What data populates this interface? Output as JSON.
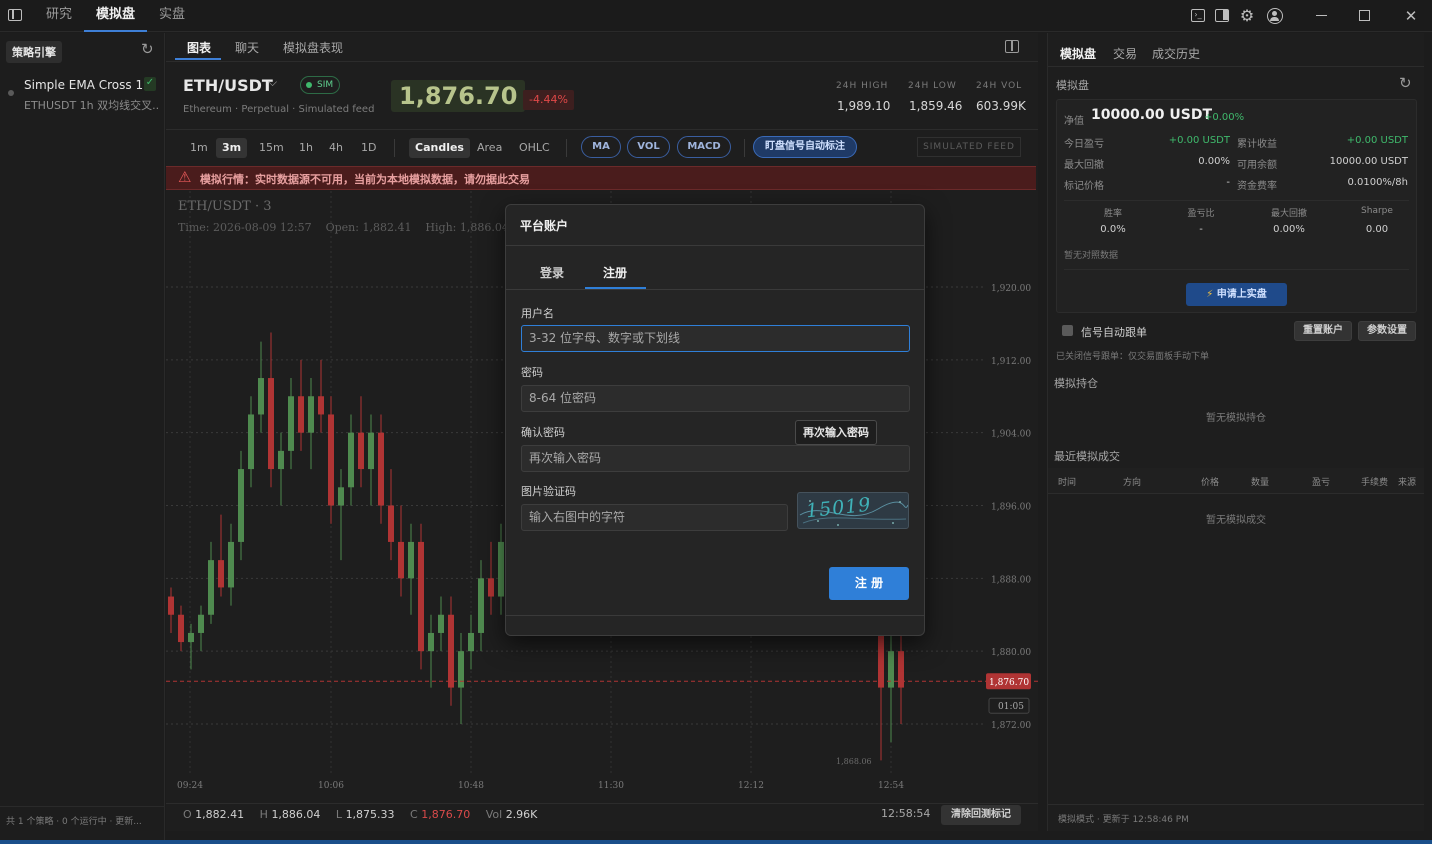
{
  "topbar": {
    "tabs": [
      "研究",
      "模拟盘",
      "实盘"
    ],
    "active_tab": "模拟盘"
  },
  "sidebar": {
    "title": "策略引擎",
    "strategy": {
      "name": "Simple EMA Cross 1h",
      "desc": "ETHUSDT 1h 双均线交叉...",
      "check": "✓"
    },
    "footer": "共 1 个策略 · 0 个运行中 · 更新..."
  },
  "chart_header": {
    "tabs": [
      "图表",
      "聊天",
      "模拟盘表现"
    ],
    "symbol": "ETH/USDT",
    "sim_badge": "SIM",
    "subtitle": "Ethereum · Perpetual · Simulated feed",
    "price": "1,876.70",
    "change": "-4.44%",
    "stats": [
      {
        "label": "24H HIGH",
        "value": "1,989.10"
      },
      {
        "label": "24H LOW",
        "value": "1,859.46"
      },
      {
        "label": "24H VOL",
        "value": "603.99K"
      }
    ]
  },
  "toolbar": {
    "timeframes": [
      "1m",
      "3m",
      "15m",
      "1h",
      "4h",
      "1D"
    ],
    "active_timeframe": "3m",
    "chart_types": [
      "Candles",
      "Area",
      "OHLC"
    ],
    "active_chart_type": "Candles",
    "indicators": [
      "MA",
      "VOL",
      "MACD"
    ],
    "signal_button": "盯盘信号自动标注",
    "feed_badge": "SIMULATED FEED"
  },
  "warning": "模拟行情：实时数据源不可用，当前为本地模拟数据，请勿据此交易",
  "legend": {
    "title": "ETH/USDT · 3",
    "line": "Time: 2026-08-09 12:57    Open: 1,882.41    High: 1,886.04    Lo"
  },
  "axes": {
    "price_ticks": [
      "1,920.00",
      "1,912.00",
      "1,904.00",
      "1,896.00",
      "1,888.00",
      "1,880.00",
      "1,872.00"
    ],
    "time_ticks": [
      "09:24",
      "10:06",
      "10:48",
      "11:30",
      "12:12",
      "12:54"
    ],
    "last_price_tag": "1,876.70",
    "countdown": "01:05",
    "low_marker": "1,868.06"
  },
  "status_bar": {
    "o_label": "O",
    "o": "1,882.41",
    "h_label": "H",
    "h": "1,886.04",
    "l_label": "L",
    "l": "1,875.33",
    "c_label": "C",
    "c": "1,876.70",
    "vol_label": "Vol",
    "vol": "2.96K",
    "time": "12:58:54",
    "clear_button": "清除回测标记"
  },
  "right": {
    "tabs": [
      "模拟盘",
      "交易",
      "成交历史"
    ],
    "section_title": "模拟盘",
    "equity_label": "净值",
    "equity": "10000.00 USDT",
    "equity_change": "+0.00%",
    "rows": [
      {
        "l1": "今日盈亏",
        "v1": "+0.00 USDT",
        "l2": "累计收益",
        "v2": "+0.00 USDT"
      },
      {
        "l1": "最大回撤",
        "v1": "0.00%",
        "l2": "可用余额",
        "v2": "10000.00 USDT"
      },
      {
        "l1": "标记价格",
        "v1": "-",
        "l2": "资金费率",
        "v2": "0.0100%/8h"
      }
    ],
    "metrics": [
      {
        "label": "胜率",
        "value": "0.0%"
      },
      {
        "label": "盈亏比",
        "value": "-"
      },
      {
        "label": "最大回撤",
        "value": "0.00%"
      },
      {
        "label": "Sharpe",
        "value": "0.00"
      }
    ],
    "no_compare": "暂无对照数据",
    "apply_button": "申请上实盘",
    "auto_follow": "信号自动跟单",
    "reset_button": "重置账户",
    "params_button": "参数设置",
    "auto_follow_note": "已关闭信号跟单：仅交易面板手动下单",
    "positions_title": "模拟持仓",
    "positions_empty": "暂无模拟持仓",
    "trades_title": "最近模拟成交",
    "trade_cols": [
      "时间",
      "方向",
      "价格",
      "数量",
      "盈亏",
      "手续费",
      "来源"
    ],
    "trades_empty": "暂无模拟成交",
    "footer": "模拟模式 · 更新于 12:58:46 PM"
  },
  "modal": {
    "title": "平台账户",
    "tabs": [
      "登录",
      "注册"
    ],
    "active_tab": "注册",
    "username_label": "用户名",
    "username_placeholder": "3-32 位字母、数字或下划线",
    "password_label": "密码",
    "password_placeholder": "8-64 位密码",
    "confirm_label": "确认密码",
    "confirm_placeholder": "再次输入密码",
    "confirm_tooltip": "再次输入密码",
    "captcha_label": "图片验证码",
    "captcha_placeholder": "输入右图中的字符",
    "captcha_text": "15019",
    "submit": "注 册"
  },
  "colors": {
    "accent": "#2f7fd8",
    "up": "#4f8a4f",
    "down": "#b03434",
    "warning_bg": "#4a1c1c"
  },
  "chart_data": {
    "type": "candlestick",
    "timeframe": "3m",
    "ylim": [
      1866,
      1922
    ],
    "candles": [
      [
        1886,
        1887,
        1882,
        1884
      ],
      [
        1884,
        1885,
        1880,
        1881
      ],
      [
        1881,
        1883,
        1878,
        1882
      ],
      [
        1882,
        1885,
        1880,
        1884
      ],
      [
        1884,
        1892,
        1883,
        1890
      ],
      [
        1890,
        1895,
        1886,
        1887
      ],
      [
        1887,
        1894,
        1885,
        1892
      ],
      [
        1892,
        1902,
        1890,
        1900
      ],
      [
        1900,
        1908,
        1898,
        1906
      ],
      [
        1906,
        1914,
        1904,
        1910
      ],
      [
        1910,
        1915,
        1898,
        1900
      ],
      [
        1900,
        1904,
        1896,
        1902
      ],
      [
        1902,
        1910,
        1900,
        1908
      ],
      [
        1908,
        1912,
        1902,
        1904
      ],
      [
        1904,
        1910,
        1900,
        1908
      ],
      [
        1908,
        1912,
        1904,
        1906
      ],
      [
        1906,
        1908,
        1894,
        1896
      ],
      [
        1896,
        1900,
        1890,
        1898
      ],
      [
        1898,
        1906,
        1896,
        1904
      ],
      [
        1904,
        1908,
        1898,
        1900
      ],
      [
        1900,
        1906,
        1896,
        1904
      ],
      [
        1904,
        1906,
        1894,
        1896
      ],
      [
        1896,
        1900,
        1890,
        1892
      ],
      [
        1892,
        1896,
        1886,
        1888
      ],
      [
        1888,
        1894,
        1884,
        1892
      ],
      [
        1892,
        1894,
        1878,
        1880
      ],
      [
        1880,
        1884,
        1876,
        1882
      ],
      [
        1882,
        1886,
        1880,
        1884
      ],
      [
        1884,
        1886,
        1874,
        1876
      ],
      [
        1876,
        1882,
        1872,
        1880
      ],
      [
        1880,
        1884,
        1878,
        1882
      ],
      [
        1882,
        1890,
        1880,
        1888
      ],
      [
        1888,
        1892,
        1884,
        1886
      ],
      [
        1886,
        1894,
        1884,
        1892
      ],
      [
        1892,
        1896,
        1888,
        1890
      ],
      [
        1886,
        1888,
        1868,
        1876
      ],
      [
        1876,
        1882,
        1870,
        1880
      ],
      [
        1880,
        1883,
        1872,
        1876
      ]
    ]
  }
}
